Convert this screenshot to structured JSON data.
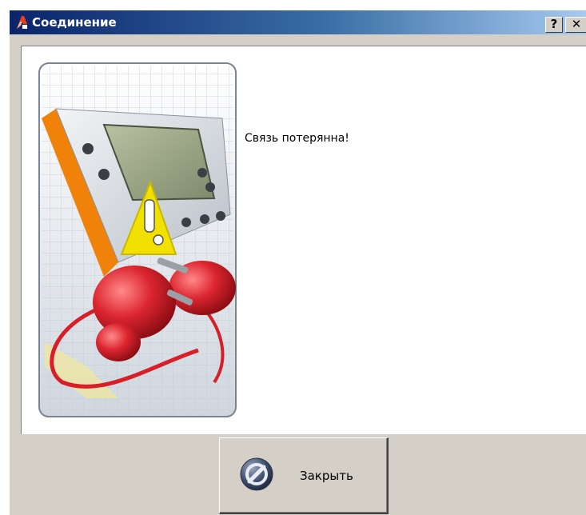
{
  "window": {
    "title": "Соединение",
    "app_icon": "app-logo-icon",
    "help_label": "?",
    "close_label": "✕"
  },
  "content": {
    "message": "Связь потерянна!",
    "illustration": "disconnected-cable-icon"
  },
  "footer": {
    "close_button_label": "Закрыть",
    "close_button_icon": "no-entry-icon"
  },
  "colors": {
    "titlebar_start": "#0a246a",
    "titlebar_end": "#a6caf0",
    "window_face": "#d4d0c8",
    "device_orange": "#f0820a",
    "plug_red": "#d81e28",
    "warning_yellow": "#f2e000"
  }
}
